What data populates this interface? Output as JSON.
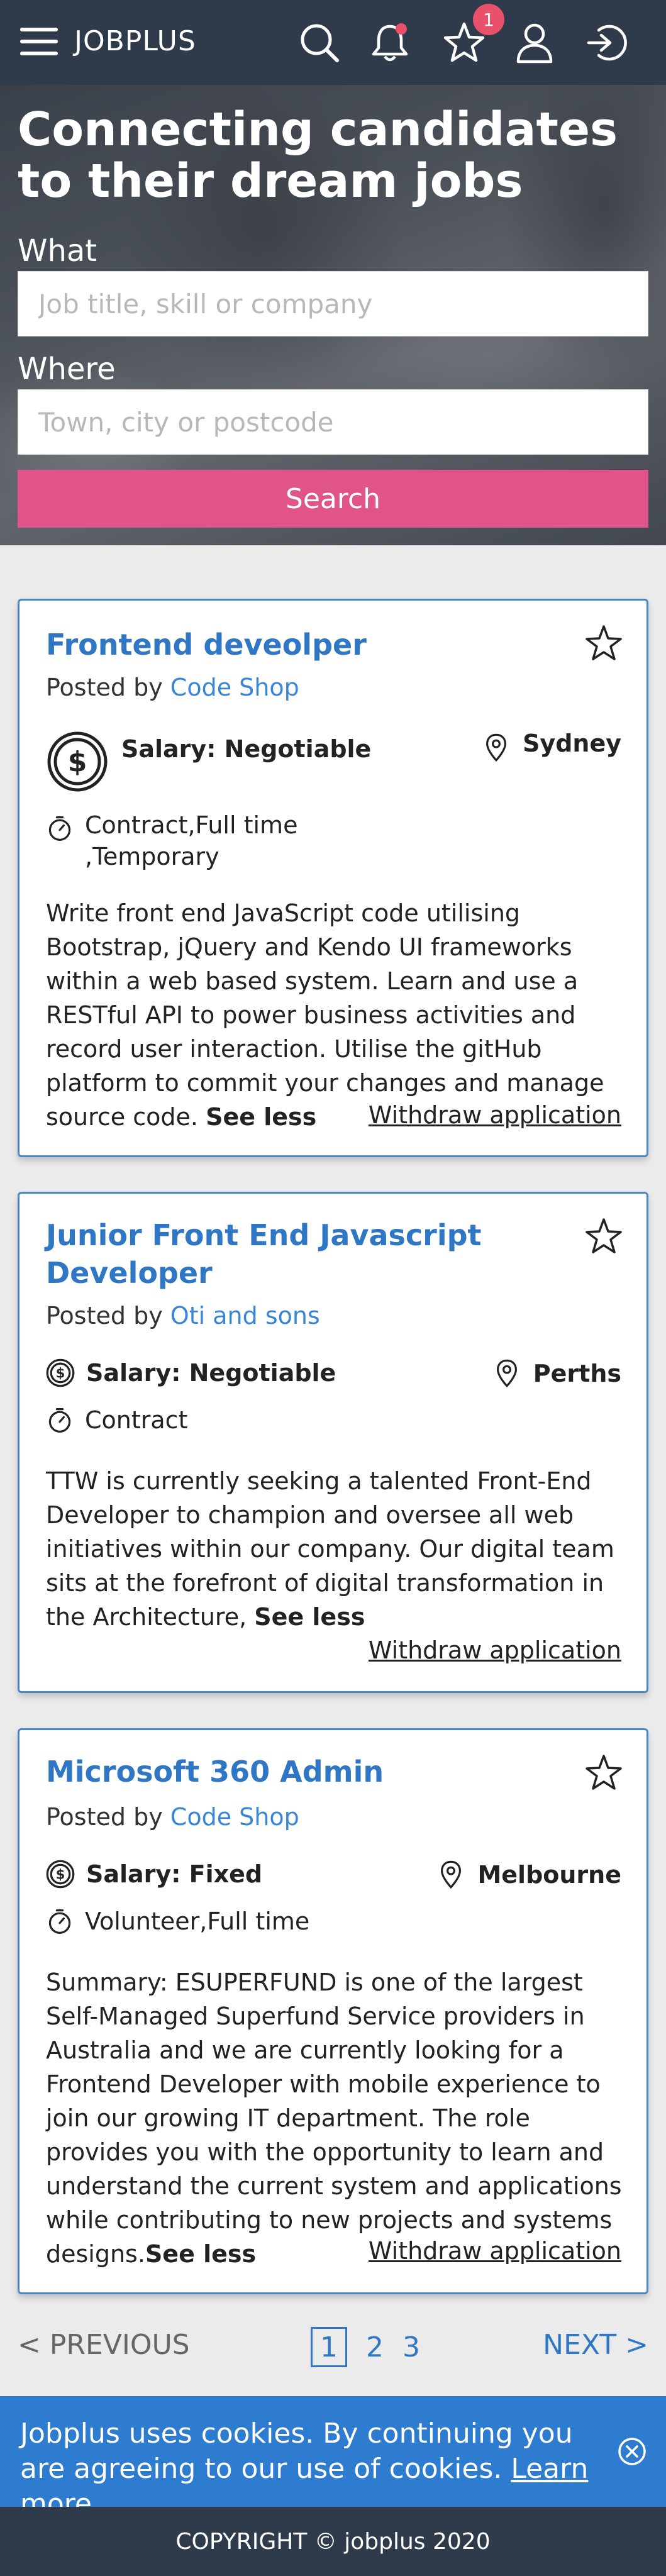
{
  "header": {
    "brand": "JOBPLUS",
    "notification_count": "1"
  },
  "hero": {
    "title": "Connecting candidates to their dream jobs",
    "what_label": "What",
    "what_placeholder": "Job title, skill or company",
    "where_label": "Where",
    "where_placeholder": "Town, city or postcode",
    "search_label": "Search"
  },
  "jobs": [
    {
      "title": "Frontend deveolper",
      "posted_by": "Posted by",
      "company": "Code Shop",
      "salary": "Salary: Negotiable",
      "location": "Sydney",
      "type": "Contract,Full time ,Temporary",
      "description": "Write front end JavaScript code utilising Bootstrap, jQuery and Kendo UI frameworks within a web based system. Learn and use a RESTful API to power business activities and record user interaction. Utilise the gitHub platform to commit your changes and manage source code.",
      "see_less": "See less",
      "withdraw": "Withdraw application"
    },
    {
      "title": "Junior Front End Javascript Developer",
      "posted_by": "Posted by",
      "company": "Oti and sons",
      "salary": "Salary: Negotiable",
      "location": "Perths",
      "type": "Contract",
      "description": "TTW is currently seeking a talented Front-End Developer to champion and oversee all web initiatives within our company. Our digital team sits at the forefront of digital transformation in the Architecture,",
      "see_less": "See less",
      "withdraw": "Withdraw application"
    },
    {
      "title": "Microsoft 360 Admin",
      "posted_by": "Posted by",
      "company": "Code Shop",
      "salary": "Salary: Fixed",
      "location": "Melbourne",
      "type": "Volunteer,Full time",
      "description": "Summary: ESUPERFUND is one of the largest Self-Managed Superfund Service providers in Australia and we are currently looking for a Frontend Developer with mobile experience to join our growing IT department. The role provides you with the opportunity to learn and understand the current system and applications while contributing to new projects and systems designs.",
      "see_less": "See less",
      "withdraw": "Withdraw application"
    }
  ],
  "pagination": {
    "prev": "< PREVIOUS",
    "pages": [
      "1",
      "2",
      "3"
    ],
    "current": "1",
    "next": "NEXT >"
  },
  "cookie": {
    "text": "Jobplus uses cookies. By continuing you are agreeing to our use of cookies.",
    "link": "Learn more",
    "period": "."
  },
  "footer": {
    "copyright": "COPYRIGHT © jobplus 2020"
  },
  "colors": {
    "header_bg": "#2f3a4a",
    "accent_blue": "#2f77c5",
    "search_pink": "#e0548a",
    "badge_red": "#e8506b",
    "cookie_blue": "#2d7cd0"
  }
}
